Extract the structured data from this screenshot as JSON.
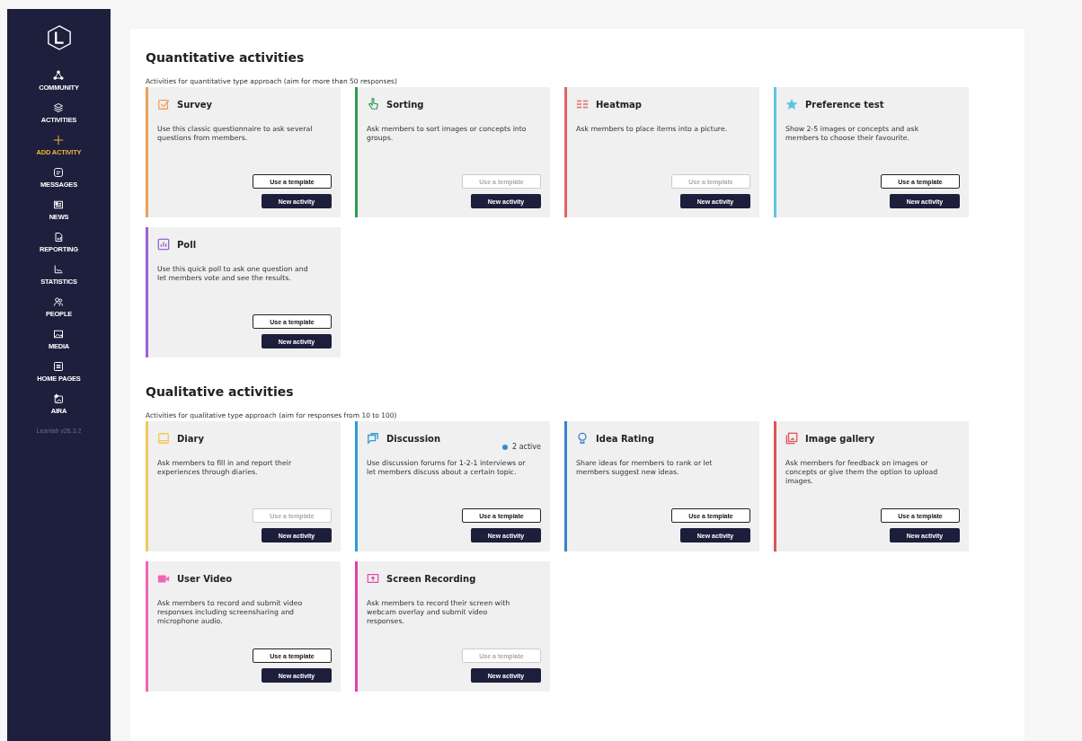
{
  "sidebar": {
    "items": [
      {
        "kind": "community",
        "label": "COMMUNITY",
        "selected": false
      },
      {
        "kind": "activities",
        "label": "ACTIVITIES",
        "selected": false
      },
      {
        "kind": "add",
        "label": "ADD ACTIVITY",
        "selected": true
      },
      {
        "kind": "messages",
        "label": "MESSAGES",
        "selected": false
      },
      {
        "kind": "news",
        "label": "NEWS",
        "selected": false
      },
      {
        "kind": "reporting",
        "label": "REPORTING",
        "selected": false
      },
      {
        "kind": "statistics",
        "label": "STATISTICS",
        "selected": false
      },
      {
        "kind": "people",
        "label": "PEOPLE",
        "selected": false
      },
      {
        "kind": "media",
        "label": "MEDIA",
        "selected": false
      },
      {
        "kind": "homepages",
        "label": "HOME PAGES",
        "selected": false
      },
      {
        "kind": "aira",
        "label": "AIRA",
        "selected": false
      }
    ],
    "version": "Leanlab v26.3.2"
  },
  "sections": [
    {
      "title": "Quantitative activities",
      "subtitle": "Activities for quantitative type approach (aim for more than 50 responses)",
      "cards": [
        {
          "kind": "survey",
          "color": "#e9a25a",
          "title": "Survey",
          "description": "Use this classic questionnaire to ask several questions from members.",
          "template_button": "Use a template",
          "template_disabled": false,
          "new_button": "New activity"
        },
        {
          "kind": "sorting",
          "color": "#2e9a55",
          "title": "Sorting",
          "description": "Ask members to sort images or concepts into groups.",
          "template_button": "Use a template",
          "template_disabled": true,
          "new_button": "New activity"
        },
        {
          "kind": "heatmap",
          "color": "#e06464",
          "title": "Heatmap",
          "description": "Ask members to place items into a picture.",
          "template_button": "Use a template",
          "template_disabled": true,
          "new_button": "New activity"
        },
        {
          "kind": "preference",
          "color": "#5cc6e2",
          "title": "Preference test",
          "description": "Show 2-5 images or concepts and ask members to choose their favourite.",
          "template_button": "Use a template",
          "template_disabled": false,
          "new_button": "New activity"
        },
        {
          "kind": "poll",
          "color": "#9b62d2",
          "title": "Poll",
          "description": "Use this quick poll to ask one question and let members vote and see the results.",
          "template_button": "Use a template",
          "template_disabled": false,
          "new_button": "New activity"
        }
      ]
    },
    {
      "title": "Qualitative activities",
      "subtitle": "Activities for qualitative type approach (aim for responses from 10 to 100)",
      "cards": [
        {
          "kind": "diary",
          "color": "#f0c95a",
          "title": "Diary",
          "description": "Ask members to fill in and report their experiences through diaries.",
          "template_button": "Use a template",
          "template_disabled": true,
          "new_button": "New activity"
        },
        {
          "kind": "discussion",
          "color": "#2f9bd2",
          "title": "Discussion",
          "badge": {
            "text": "2 active",
            "color": "#2f8fd0"
          },
          "description": "Use discussion forums for 1-2-1 interviews or let members discuss about a certain topic.",
          "template_button": "Use a template",
          "template_disabled": false,
          "new_button": "New activity"
        },
        {
          "kind": "idea",
          "color": "#3a80d2",
          "title": "Idea Rating",
          "description": "Share ideas for members to rank or let members suggest new ideas.",
          "template_button": "Use a template",
          "template_disabled": false,
          "new_button": "New activity"
        },
        {
          "kind": "gallery",
          "color": "#e05555",
          "title": "Image gallery",
          "description": "Ask members for feedback on images or concepts or give them the option to upload images.",
          "template_button": "Use a template",
          "template_disabled": false,
          "new_button": "New activity"
        },
        {
          "kind": "video",
          "color": "#f065b5",
          "title": "User Video",
          "description": "Ask members to record and submit video responses including screensharing and microphone audio.",
          "template_button": "Use a template",
          "template_disabled": false,
          "new_button": "New activity"
        },
        {
          "kind": "screen",
          "color": "#e040a8",
          "title": "Screen Recording",
          "description": "Ask members to record their screen with webcam overlay and submit video responses.",
          "template_button": "Use a template",
          "template_disabled": true,
          "new_button": "New activity"
        }
      ]
    }
  ]
}
